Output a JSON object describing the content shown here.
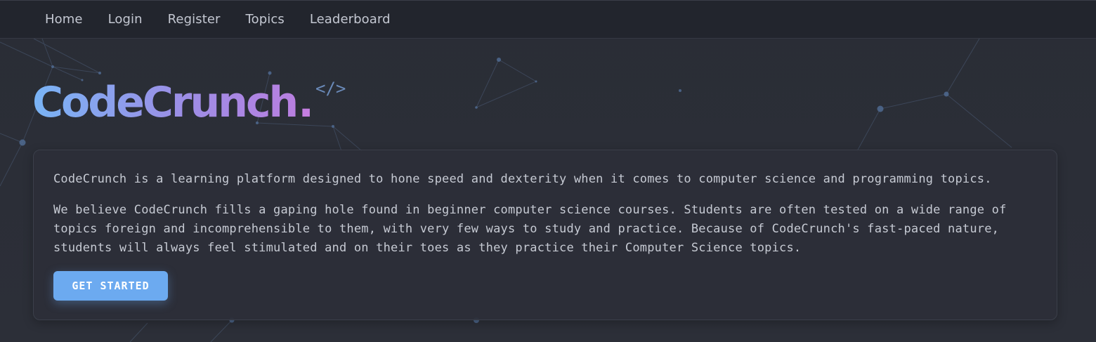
{
  "nav": {
    "items": [
      {
        "label": "Home"
      },
      {
        "label": "Login"
      },
      {
        "label": "Register"
      },
      {
        "label": "Topics"
      },
      {
        "label": "Leaderboard"
      }
    ]
  },
  "brand": {
    "name": "CodeCrunch",
    "dot": ".",
    "code_glyph": "</>"
  },
  "intro": {
    "paragraph_1": "CodeCrunch is a learning platform designed to hone speed and dexterity when it comes to computer science and programming topics.",
    "paragraph_2": "We believe CodeCrunch fills a gaping hole found in beginner computer science courses. Students are often tested on a wide range of topics foreign and incomprehensible to them, with very few ways to study and practice. Because of CodeCrunch's fast-paced nature, students will always feel stimulated and on their toes as they practice their Computer Science topics.",
    "cta_label": "GET STARTED"
  },
  "colors": {
    "background": "#2a2d36",
    "navbar": "#22252d",
    "accent": "#6caaf0",
    "brand_gradient_start": "#79b4f5",
    "brand_gradient_end": "#b87fe0"
  }
}
